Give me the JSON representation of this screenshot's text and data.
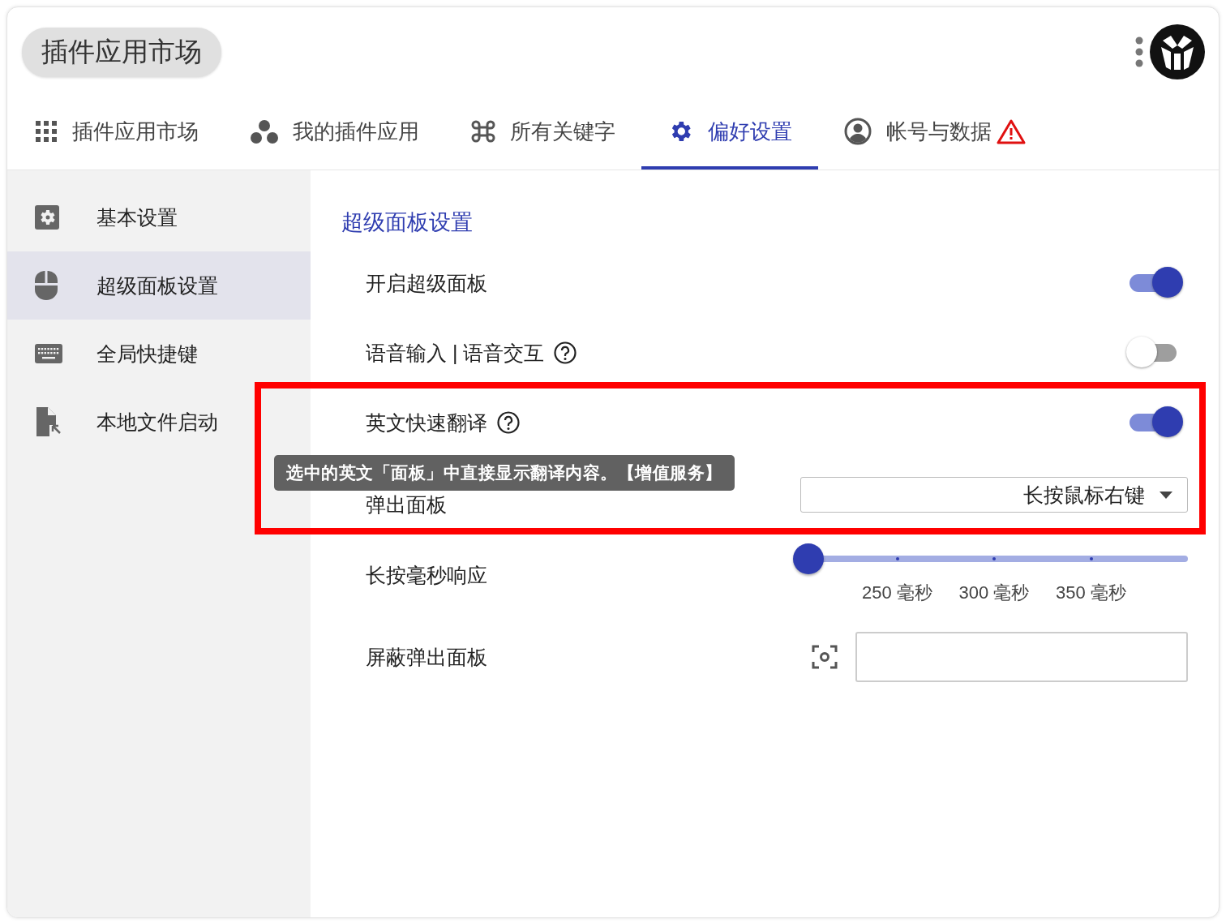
{
  "app": {
    "title": "插件应用市场"
  },
  "tabs": [
    {
      "label": "插件应用市场",
      "selected": false,
      "warning": false
    },
    {
      "label": "我的插件应用",
      "selected": false,
      "warning": false
    },
    {
      "label": "所有关键字",
      "selected": false,
      "warning": false
    },
    {
      "label": "偏好设置",
      "selected": true,
      "warning": false
    },
    {
      "label": "帐号与数据",
      "selected": false,
      "warning": true
    }
  ],
  "sidebar": {
    "items": [
      {
        "label": "基本设置",
        "selected": false
      },
      {
        "label": "超级面板设置",
        "selected": true
      },
      {
        "label": "全局快捷键",
        "selected": false
      },
      {
        "label": "本地文件启动",
        "selected": false
      }
    ]
  },
  "panel": {
    "title": "超级面板设置",
    "rows": [
      {
        "kind": "toggle",
        "label": "开启超级面板",
        "help": false,
        "on": true
      },
      {
        "kind": "toggle",
        "label": "语音输入 | 语音交互",
        "help": true,
        "on": false
      },
      {
        "kind": "toggle",
        "label": "英文快速翻译",
        "help": true,
        "on": true
      },
      {
        "kind": "select",
        "label": "弹出面板",
        "value": "长按鼠标右键"
      },
      {
        "kind": "slider",
        "label": "长按毫秒响应",
        "level": 0,
        "tick_labels": [
          "250 毫秒",
          "300 毫秒",
          "350 毫秒"
        ]
      },
      {
        "kind": "capture",
        "label": "屏蔽弹出面板"
      }
    ]
  },
  "tooltip": {
    "text": "选中的英文「面板」中直接显示翻译内容。【增值服务】"
  }
}
